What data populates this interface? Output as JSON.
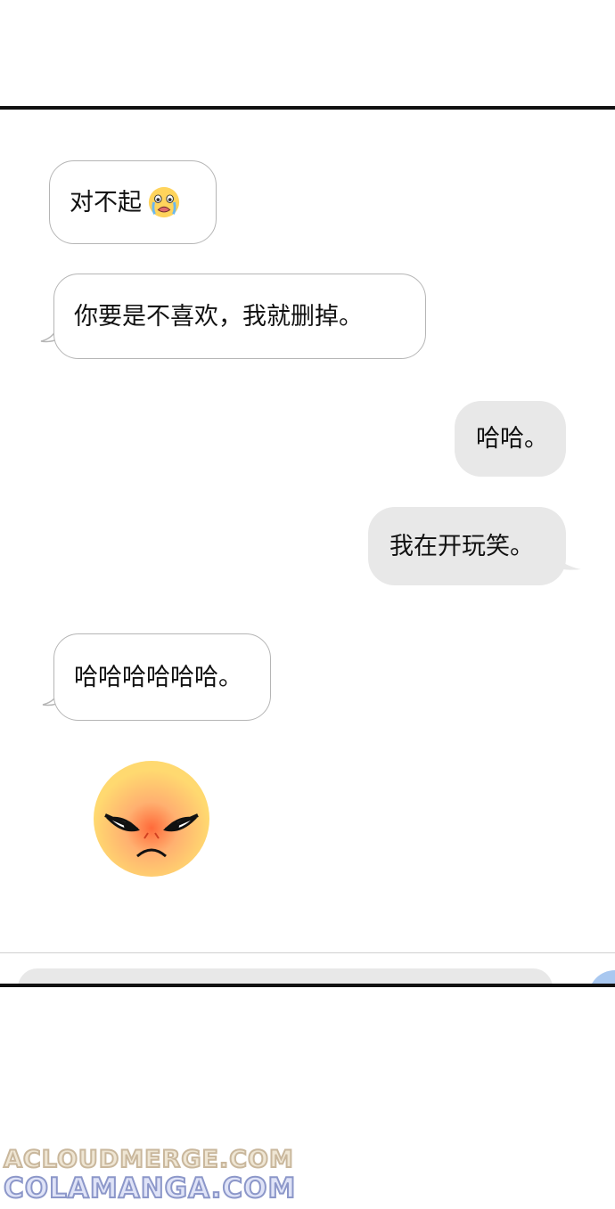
{
  "messages": [
    {
      "side": "in",
      "text": "对不起",
      "emoji": "crying-face"
    },
    {
      "side": "in",
      "text": "你要是不喜欢，我就删掉。"
    },
    {
      "side": "out",
      "text": "哈哈。"
    },
    {
      "side": "out",
      "text": "我在开玩笑。"
    },
    {
      "side": "in",
      "text": "哈哈哈哈哈哈。"
    }
  ],
  "sticker": {
    "name": "angry-face-sticker"
  },
  "colors": {
    "incoming_border": "#b5b5b5",
    "outgoing_bg": "#e8e8e8",
    "send_button": "#a9c8f0"
  },
  "watermark": {
    "line1": "ACLOUDMERGE.COM",
    "line2": "COLAMANGA.COM"
  }
}
